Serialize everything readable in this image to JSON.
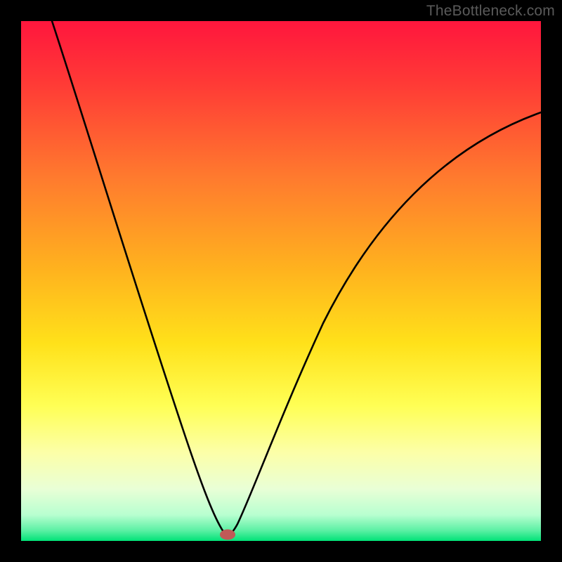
{
  "watermark": "TheBottleneck.com",
  "chart_data": {
    "type": "line",
    "title": "",
    "xlabel": "",
    "ylabel": "",
    "xlim": [
      0,
      100
    ],
    "ylim": [
      0,
      100
    ],
    "grid": false,
    "legend": false,
    "annotations": [],
    "background_gradient": {
      "top": "#ff1a3a",
      "mid1": "#ff7a2a",
      "mid2": "#ffd21e",
      "mid3": "#ffff66",
      "mid4": "#f6ffc1",
      "bottom": "#00e477"
    },
    "marker": {
      "x": 39.5,
      "y": 1.2,
      "color": "#c05a57"
    },
    "series": [
      {
        "name": "curve",
        "x": [
          6,
          10,
          15,
          20,
          25,
          30,
          35,
          38,
          39.5,
          41,
          44,
          48,
          55,
          62,
          70,
          78,
          86,
          94,
          100
        ],
        "y": [
          100,
          88,
          73,
          58,
          44,
          30,
          16,
          6,
          1,
          5,
          16,
          30,
          48,
          58,
          66,
          72,
          76.5,
          80,
          82
        ]
      }
    ]
  }
}
